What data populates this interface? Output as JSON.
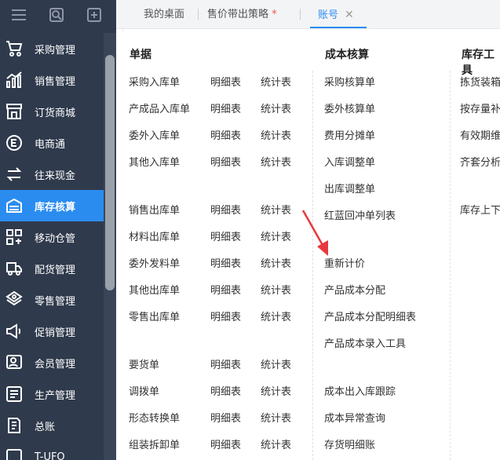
{
  "sidebar": {
    "top_icons": [
      "menu-icon",
      "search-icon",
      "add-window-icon"
    ],
    "items": [
      {
        "label": "采购管理",
        "icon": "cart-icon"
      },
      {
        "label": "销售管理",
        "icon": "sales-chart-icon"
      },
      {
        "label": "订货商城",
        "icon": "store-icon"
      },
      {
        "label": "电商通",
        "icon": "ecommerce-icon"
      },
      {
        "label": "往来现金",
        "icon": "exchange-icon"
      },
      {
        "label": "库存核算",
        "icon": "inventory-icon",
        "active": true
      },
      {
        "label": "移动仓管",
        "icon": "grid-icon"
      },
      {
        "label": "配货管理",
        "icon": "truck-icon"
      },
      {
        "label": "零售管理",
        "icon": "retail-icon"
      },
      {
        "label": "促销管理",
        "icon": "megaphone-icon"
      },
      {
        "label": "会员管理",
        "icon": "member-icon"
      },
      {
        "label": "生产管理",
        "icon": "production-icon"
      },
      {
        "label": "总账",
        "icon": "ledger-icon"
      },
      {
        "label": "T-UFO",
        "icon": "report-icon"
      }
    ]
  },
  "tabs": [
    {
      "label": "我的桌面"
    },
    {
      "label": "售价带出策略",
      "modified": "*"
    },
    {
      "label": "账号",
      "active": true,
      "close": "✕"
    }
  ],
  "sections": {
    "documents": "单据",
    "cost_accounting": "成本核算",
    "inventory_tools": "库存工具"
  },
  "columns": {
    "detail": "明细表",
    "stats": "统计表"
  },
  "document_rows": [
    "采购入库单",
    "产成品入库单",
    "委外入库单",
    "其他入库单",
    "销售出库单",
    "材料出库单",
    "委外发料单",
    "其他出库单",
    "零售出库单",
    "要货单",
    "调拨单",
    "形态转换单",
    "组装拆卸单"
  ],
  "cost_items": [
    "采购核算单",
    "委外核算单",
    "费用分摊单",
    "入库调整单",
    "出库调整单",
    "红蓝回冲单列表",
    "重新计价",
    "产品成本分配",
    "产品成本分配明细表",
    "产品成本录入工具",
    "成本出入库跟踪",
    "成本异常查询",
    "存货明细账"
  ],
  "tool_items": [
    "拣货装箱",
    "按存量补",
    "有效期维",
    "齐套分析",
    "库存上下"
  ],
  "colors": {
    "sidebar": "#2f3a4c",
    "accent": "#2b8cf0",
    "arrow": "#e8383d"
  }
}
